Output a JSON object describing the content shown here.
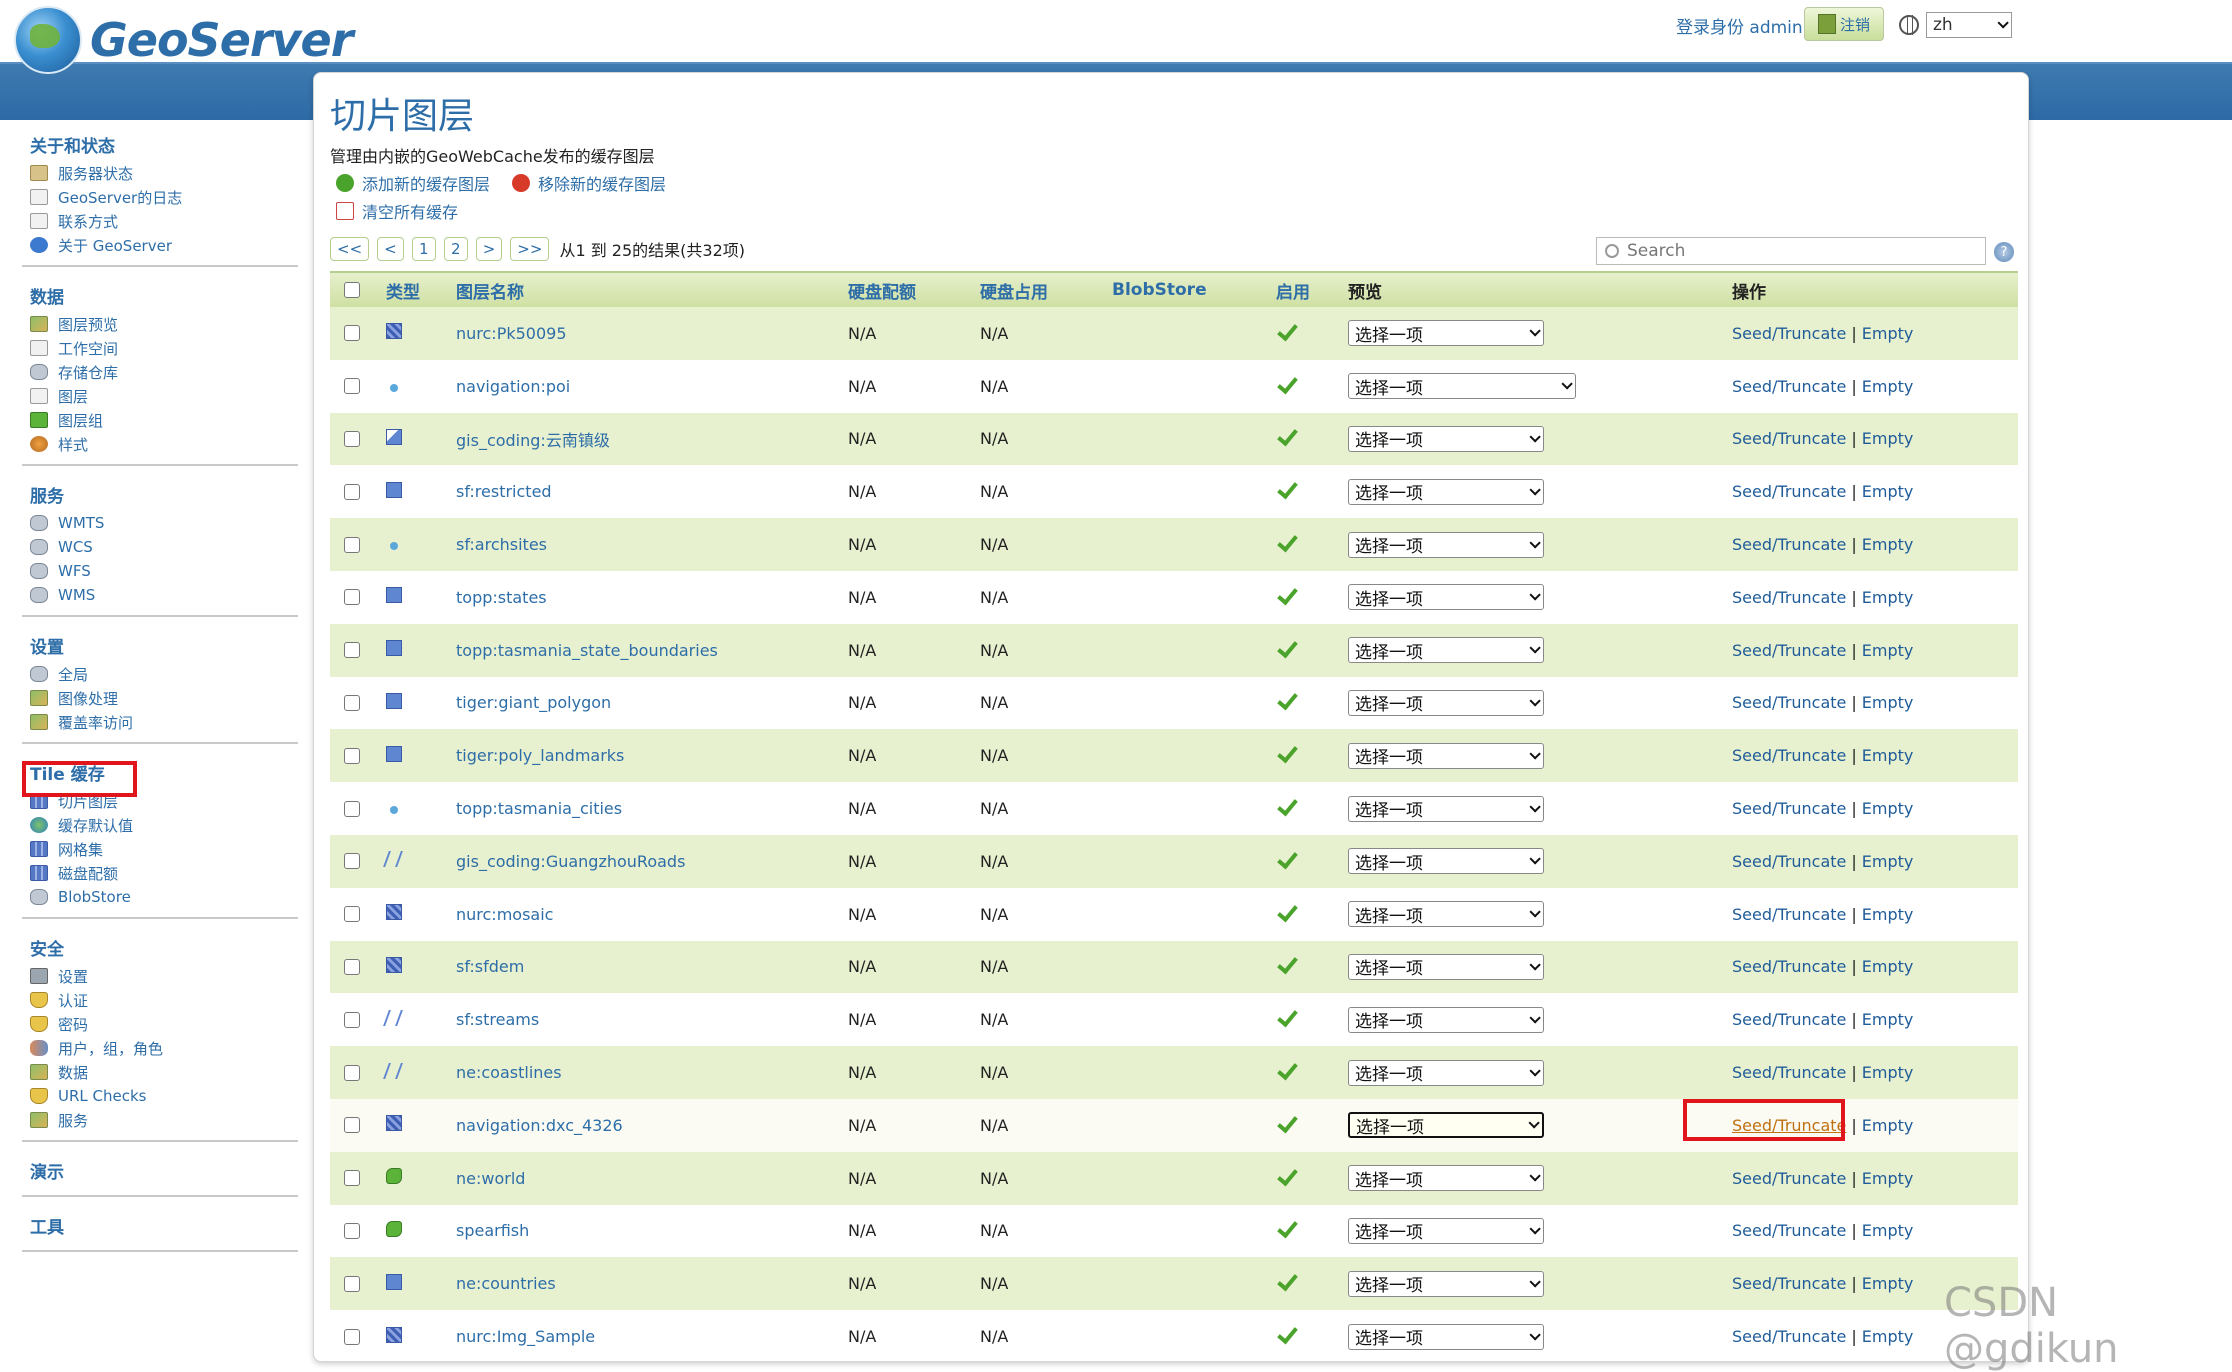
{
  "header": {
    "logo_text": "GeoServer",
    "login_info": "登录身份 admin.",
    "logout_label": "注销",
    "lang_value": "zh"
  },
  "sidebar": {
    "sections": [
      {
        "title": "关于和状态",
        "items": [
          {
            "label": "服务器状态",
            "icon": "doc"
          },
          {
            "label": "GeoServer的日志",
            "icon": "page"
          },
          {
            "label": "联系方式",
            "icon": "page"
          },
          {
            "label": "关于 GeoServer",
            "icon": "info"
          }
        ]
      },
      {
        "title": "数据",
        "items": [
          {
            "label": "图层预览",
            "icon": "map"
          },
          {
            "label": "工作空间",
            "icon": "page"
          },
          {
            "label": "存储仓库",
            "icon": "db"
          },
          {
            "label": "图层",
            "icon": "page"
          },
          {
            "label": "图层组",
            "icon": "green"
          },
          {
            "label": "样式",
            "icon": "style"
          }
        ]
      },
      {
        "title": "服务",
        "items": [
          {
            "label": "WMTS",
            "icon": "db"
          },
          {
            "label": "WCS",
            "icon": "db"
          },
          {
            "label": "WFS",
            "icon": "db"
          },
          {
            "label": "WMS",
            "icon": "db"
          }
        ]
      },
      {
        "title": "设置",
        "items": [
          {
            "label": "全局",
            "icon": "db"
          },
          {
            "label": "图像处理",
            "icon": "map"
          },
          {
            "label": "覆盖率访问",
            "icon": "map"
          }
        ]
      },
      {
        "title": "Tile 缓存",
        "items": [
          {
            "label": "切片图层",
            "icon": "grid"
          },
          {
            "label": "缓存默认值",
            "icon": "globe"
          },
          {
            "label": "网格集",
            "icon": "grid"
          },
          {
            "label": "磁盘配额",
            "icon": "grid"
          },
          {
            "label": "BlobStore",
            "icon": "db"
          }
        ]
      },
      {
        "title": "安全",
        "items": [
          {
            "label": "设置",
            "icon": "key"
          },
          {
            "label": "认证",
            "icon": "shield"
          },
          {
            "label": "密码",
            "icon": "shield"
          },
          {
            "label": "用户，组，角色",
            "icon": "users"
          },
          {
            "label": "数据",
            "icon": "map"
          },
          {
            "label": "URL Checks",
            "icon": "shield"
          },
          {
            "label": "服务",
            "icon": "map"
          }
        ]
      },
      {
        "title": "演示",
        "items": []
      },
      {
        "title": "工具",
        "items": []
      }
    ]
  },
  "main": {
    "title": "切片图层",
    "description": "管理由内嵌的GeoWebCache发布的缓存图层",
    "actions": {
      "add": "添加新的缓存图层",
      "remove": "移除新的缓存图层",
      "clear": "清空所有缓存"
    },
    "pager": {
      "first": "<<",
      "prev": "<",
      "pages": [
        "1",
        "2"
      ],
      "next": ">",
      "last": ">>",
      "summary": "从1 到 25的结果(共32项)"
    },
    "search_placeholder": "Search",
    "help": "?",
    "columns": {
      "type": "类型",
      "name": "图层名称",
      "quota": "硬盘配额",
      "usage": "硬盘占用",
      "blobstore": "BlobStore",
      "enabled": "启用",
      "preview": "预览",
      "ops": "操作"
    },
    "rows": [
      {
        "type": "raster",
        "name": "nurc:Pk50095",
        "quota": "N/A",
        "usage": "N/A",
        "preview": "选择一项",
        "seed": "Seed/Truncate",
        "empty": "Empty"
      },
      {
        "type": "point",
        "name": "navigation:poi",
        "quota": "N/A",
        "usage": "N/A",
        "preview": "选择一项",
        "seed": "Seed/Truncate",
        "empty": "Empty"
      },
      {
        "type": "polyalt",
        "name": "gis_coding:云南镇级",
        "quota": "N/A",
        "usage": "N/A",
        "preview": "选择一项",
        "seed": "Seed/Truncate",
        "empty": "Empty"
      },
      {
        "type": "poly",
        "name": "sf:restricted",
        "quota": "N/A",
        "usage": "N/A",
        "preview": "选择一项",
        "seed": "Seed/Truncate",
        "empty": "Empty"
      },
      {
        "type": "point",
        "name": "sf:archsites",
        "quota": "N/A",
        "usage": "N/A",
        "preview": "选择一项",
        "seed": "Seed/Truncate",
        "empty": "Empty"
      },
      {
        "type": "poly",
        "name": "topp:states",
        "quota": "N/A",
        "usage": "N/A",
        "preview": "选择一项",
        "seed": "Seed/Truncate",
        "empty": "Empty"
      },
      {
        "type": "poly",
        "name": "topp:tasmania_state_boundaries",
        "quota": "N/A",
        "usage": "N/A",
        "preview": "选择一项",
        "seed": "Seed/Truncate",
        "empty": "Empty"
      },
      {
        "type": "poly",
        "name": "tiger:giant_polygon",
        "quota": "N/A",
        "usage": "N/A",
        "preview": "选择一项",
        "seed": "Seed/Truncate",
        "empty": "Empty"
      },
      {
        "type": "poly",
        "name": "tiger:poly_landmarks",
        "quota": "N/A",
        "usage": "N/A",
        "preview": "选择一项",
        "seed": "Seed/Truncate",
        "empty": "Empty"
      },
      {
        "type": "point",
        "name": "topp:tasmania_cities",
        "quota": "N/A",
        "usage": "N/A",
        "preview": "选择一项",
        "seed": "Seed/Truncate",
        "empty": "Empty"
      },
      {
        "type": "line",
        "name": "gis_coding:GuangzhouRoads",
        "quota": "N/A",
        "usage": "N/A",
        "preview": "选择一项",
        "seed": "Seed/Truncate",
        "empty": "Empty"
      },
      {
        "type": "raster",
        "name": "nurc:mosaic",
        "quota": "N/A",
        "usage": "N/A",
        "preview": "选择一项",
        "seed": "Seed/Truncate",
        "empty": "Empty"
      },
      {
        "type": "raster",
        "name": "sf:sfdem",
        "quota": "N/A",
        "usage": "N/A",
        "preview": "选择一项",
        "seed": "Seed/Truncate",
        "empty": "Empty"
      },
      {
        "type": "line",
        "name": "sf:streams",
        "quota": "N/A",
        "usage": "N/A",
        "preview": "选择一项",
        "seed": "Seed/Truncate",
        "empty": "Empty"
      },
      {
        "type": "line",
        "name": "ne:coastlines",
        "quota": "N/A",
        "usage": "N/A",
        "preview": "选择一项",
        "seed": "Seed/Truncate",
        "empty": "Empty"
      },
      {
        "type": "raster",
        "name": "navigation:dxc_4326",
        "quota": "N/A",
        "usage": "N/A",
        "preview": "选择一项",
        "seed": "Seed/Truncate",
        "empty": "Empty"
      },
      {
        "type": "group",
        "name": "ne:world",
        "quota": "N/A",
        "usage": "N/A",
        "preview": "选择一项",
        "seed": "Seed/Truncate",
        "empty": "Empty"
      },
      {
        "type": "group",
        "name": "spearfish",
        "quota": "N/A",
        "usage": "N/A",
        "preview": "选择一项",
        "seed": "Seed/Truncate",
        "empty": "Empty"
      },
      {
        "type": "poly",
        "name": "ne:countries",
        "quota": "N/A",
        "usage": "N/A",
        "preview": "选择一项",
        "seed": "Seed/Truncate",
        "empty": "Empty"
      },
      {
        "type": "raster",
        "name": "nurc:Img_Sample",
        "quota": "N/A",
        "usage": "N/A",
        "preview": "选择一项",
        "seed": "Seed/Truncate",
        "empty": "Empty"
      }
    ]
  },
  "watermark": "CSDN @gdikun"
}
